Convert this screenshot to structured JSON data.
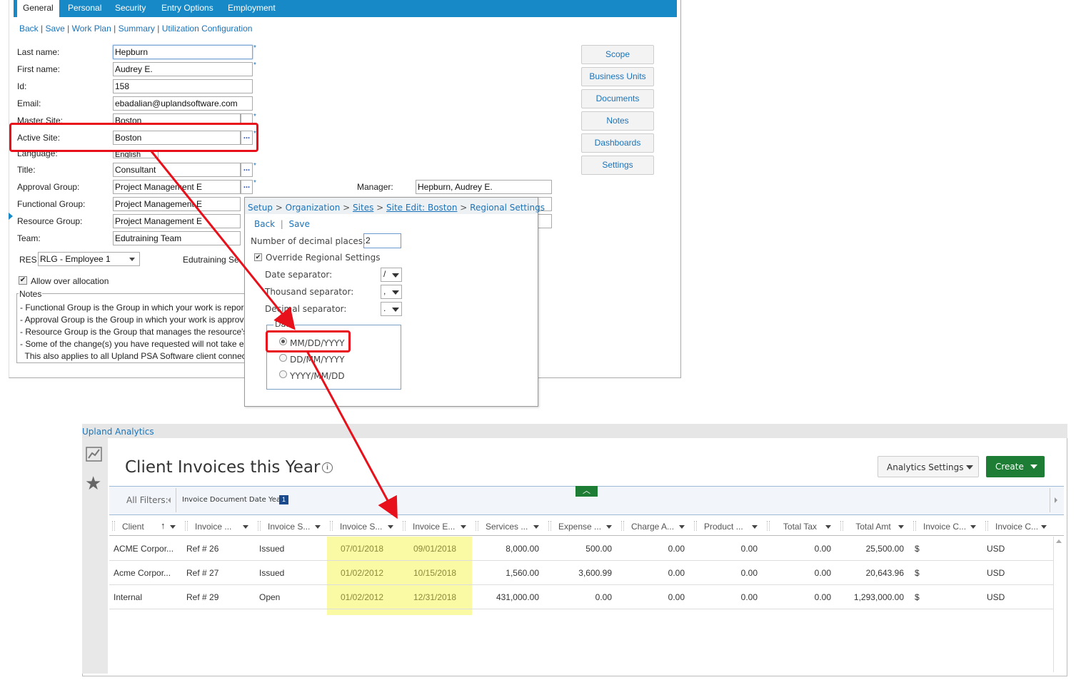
{
  "employee": {
    "tabs": [
      "General",
      "Personal",
      "Security",
      "Entry Options",
      "Employment"
    ],
    "links": [
      "Back",
      "Save",
      "Work Plan",
      "Summary",
      "Utilization Configuration"
    ],
    "fields": {
      "last_name": {
        "label": "Last name:",
        "value": "Hepburn"
      },
      "first_name": {
        "label": "First name:",
        "value": "Audrey E."
      },
      "id": {
        "label": "Id:",
        "value": "158"
      },
      "email": {
        "label": "Email:",
        "value": "ebadalian@uplandsoftware.com"
      },
      "master_site": {
        "label": "Master Site:",
        "value": "Boston"
      },
      "active_site": {
        "label": "Active Site:",
        "value": "Boston"
      },
      "language": {
        "label": "Language:",
        "value": "English"
      },
      "title": {
        "label": "Title:",
        "value": "Consultant"
      },
      "approval_group": {
        "label": "Approval Group:",
        "value": "Project Management E"
      },
      "functional_group": {
        "label": "Functional Group:",
        "value": "Project Management E"
      },
      "resource_group": {
        "label": "Resource Group:",
        "value": "Project Management E"
      },
      "team": {
        "label": "Team:",
        "value": "Edutraining Team"
      },
      "manager": {
        "label": "Manager:",
        "value": "Hepburn, Audrey E."
      }
    },
    "res": {
      "label": "RES",
      "value": "RLG - Employee 1",
      "extra": "Edutraining Se"
    },
    "allow_over_allocation": "Allow over allocation",
    "notes_label": "Notes",
    "notes": [
      "- Functional Group is the Group in which your work is repor",
      "- Approval Group is the Group in which your work is approv",
      "- Resource Group is the Group that manages the resource's",
      "- Some of the change(s) you have requested will not take e",
      "  This also applies to all Upland PSA Software client connec"
    ],
    "side_buttons": [
      "Scope",
      "Business Units",
      "Documents",
      "Notes",
      "Dashboards",
      "Settings"
    ]
  },
  "regional": {
    "breadcrumb": [
      "Setup",
      "Organization",
      "Sites",
      "Site Edit: Boston",
      "Regional Settings"
    ],
    "links": [
      "Back",
      "Save"
    ],
    "decimal_places_label": "Number of decimal places:",
    "decimal_places_value": "2",
    "override_label": "Override Regional Settings",
    "date_separator_label": "Date separator:",
    "date_separator_value": "/",
    "thousand_separator_label": "Thousand separator:",
    "thousand_separator_value": ",",
    "decimal_separator_label": "Decimal separator:",
    "decimal_separator_value": ".",
    "date_group_label": "Date",
    "date_formats": [
      "MM/DD/YYYY",
      "DD/MM/YYYY",
      "YYYY/MM/DD"
    ]
  },
  "analytics": {
    "header": "Upland Analytics",
    "title": "Client Invoices this Year",
    "settings_button": "Analytics Settings",
    "create_button": "Create",
    "filters_label": "All Filters:",
    "filter_chip": "Invoice Document Date Year",
    "filter_count": "1",
    "columns": [
      "Client",
      "Invoice ...",
      "Invoice S...",
      "Invoice S...",
      "Invoice E...",
      "Services ...",
      "Expense ...",
      "Charge A...",
      "Product ...",
      "Total Tax",
      "Total Amt",
      "Invoice C...",
      "Invoice C..."
    ],
    "rows": [
      [
        "ACME Corpor...",
        "Ref # 26",
        "Issued",
        "07/01/2018",
        "09/01/2018",
        "8,000.00",
        "500.00",
        "0.00",
        "0.00",
        "0.00",
        "25,500.00",
        "$",
        "USD"
      ],
      [
        "Acme Corpor...",
        "Ref # 27",
        "Issued",
        "01/02/2012",
        "10/15/2018",
        "1,560.00",
        "3,600.99",
        "0.00",
        "0.00",
        "0.00",
        "20,643.96",
        "$",
        "USD"
      ],
      [
        "Internal",
        "Ref # 29",
        "Open",
        "01/02/2012",
        "12/31/2018",
        "431,000.00",
        "0.00",
        "0.00",
        "0.00",
        "0.00",
        "1,293,000.00",
        "$",
        "USD"
      ]
    ]
  },
  "colors": {
    "tab_bar": "#1689c6",
    "link": "#1a73b8",
    "annotation": "#e8101a",
    "highlight": "#fafaa4",
    "create": "#1e7d34"
  }
}
